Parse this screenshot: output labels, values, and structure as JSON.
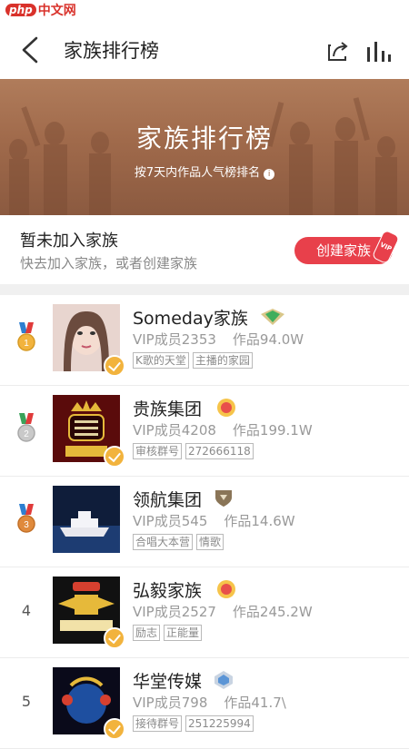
{
  "watermark": {
    "php": "php",
    "site": "中文网"
  },
  "nav": {
    "title": "家族排行榜"
  },
  "banner": {
    "title": "家族排行榜",
    "subtitle": "按7天内作品人气榜排名"
  },
  "join": {
    "title": "暂未加入家族",
    "subtitle": "快去加入家族，或者创建家族",
    "create_label": "创建家族",
    "vip_badge": "VIP"
  },
  "families": [
    {
      "rank": "1",
      "name": "Someday家族",
      "members": "VIP成员2353",
      "works": "作品94.0W",
      "tags": [
        "K歌的天堂",
        "主播的家园"
      ]
    },
    {
      "rank": "2",
      "name": "贵族集团",
      "members": "VIP成员4208",
      "works": "作品199.1W",
      "tags": [
        "审核群号",
        "272666118"
      ]
    },
    {
      "rank": "3",
      "name": "领航集团",
      "members": "VIP成员545",
      "works": "作品14.6W",
      "tags": [
        "合唱大本营",
        "情歌"
      ]
    },
    {
      "rank": "4",
      "name": "弘毅家族",
      "members": "VIP成员2527",
      "works": "作品245.2W",
      "tags": [
        "励志",
        "正能量"
      ]
    },
    {
      "rank": "5",
      "name": "华堂传媒",
      "members": "VIP成员798",
      "works": "作品41.7\\",
      "tags": [
        "接待群号",
        "251225994"
      ]
    }
  ],
  "colors": {
    "accent": "#e8404b",
    "banner": "#a06a4b",
    "gold": "#f2b33d"
  }
}
